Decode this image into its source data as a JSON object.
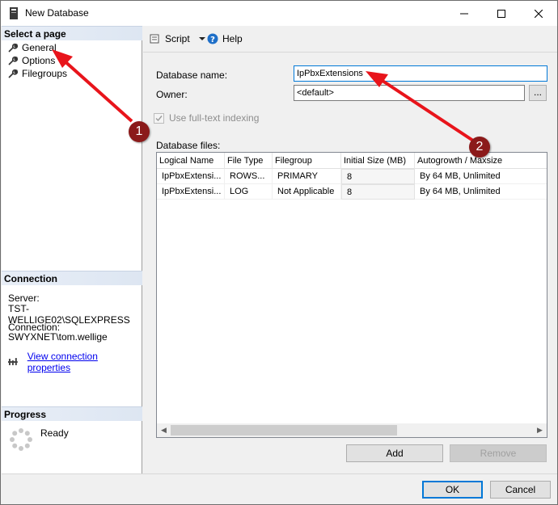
{
  "window": {
    "title": "New Database",
    "controls": [
      "minimize-icon",
      "maximize-icon",
      "close-icon"
    ]
  },
  "left_panel": {
    "select_page_header": "Select a page",
    "pages": [
      {
        "label": "General",
        "icon": "wrench-icon"
      },
      {
        "label": "Options",
        "icon": "wrench-icon"
      },
      {
        "label": "Filegroups",
        "icon": "wrench-icon"
      }
    ],
    "connection_header": "Connection",
    "server_label": "Server:",
    "server_value": "TST-WELLIGE02\\SQLEXPRESS",
    "connection_label": "Connection:",
    "connection_value": "SWYXNET\\tom.wellige",
    "view_properties_link": "View connection properties",
    "progress_header": "Progress",
    "progress_status": "Ready"
  },
  "toolbar": {
    "script_label": "Script",
    "help_label": "Help"
  },
  "form": {
    "database_name_label": "Database name:",
    "database_name_value": "IpPbxExtensions",
    "owner_label": "Owner:",
    "owner_value": "<default>",
    "owner_browse_label": "...",
    "fulltext_label": "Use full-text indexing",
    "fulltext_checked": true,
    "database_files_label": "Database files:"
  },
  "files_table": {
    "columns": [
      "Logical Name",
      "File Type",
      "Filegroup",
      "Initial Size (MB)",
      "Autogrowth / Maxsize"
    ],
    "rows": [
      [
        "IpPbxExtensi...",
        "ROWS...",
        "PRIMARY",
        "8",
        "By 64 MB, Unlimited"
      ],
      [
        "IpPbxExtensi...",
        "LOG",
        "Not Applicable",
        "8",
        "By 64 MB, Unlimited"
      ]
    ]
  },
  "buttons": {
    "add": "Add",
    "remove": "Remove",
    "ok": "OK",
    "cancel": "Cancel"
  },
  "annotations": {
    "badge_1": "1",
    "badge_2": "2",
    "color": "#e8141b"
  }
}
